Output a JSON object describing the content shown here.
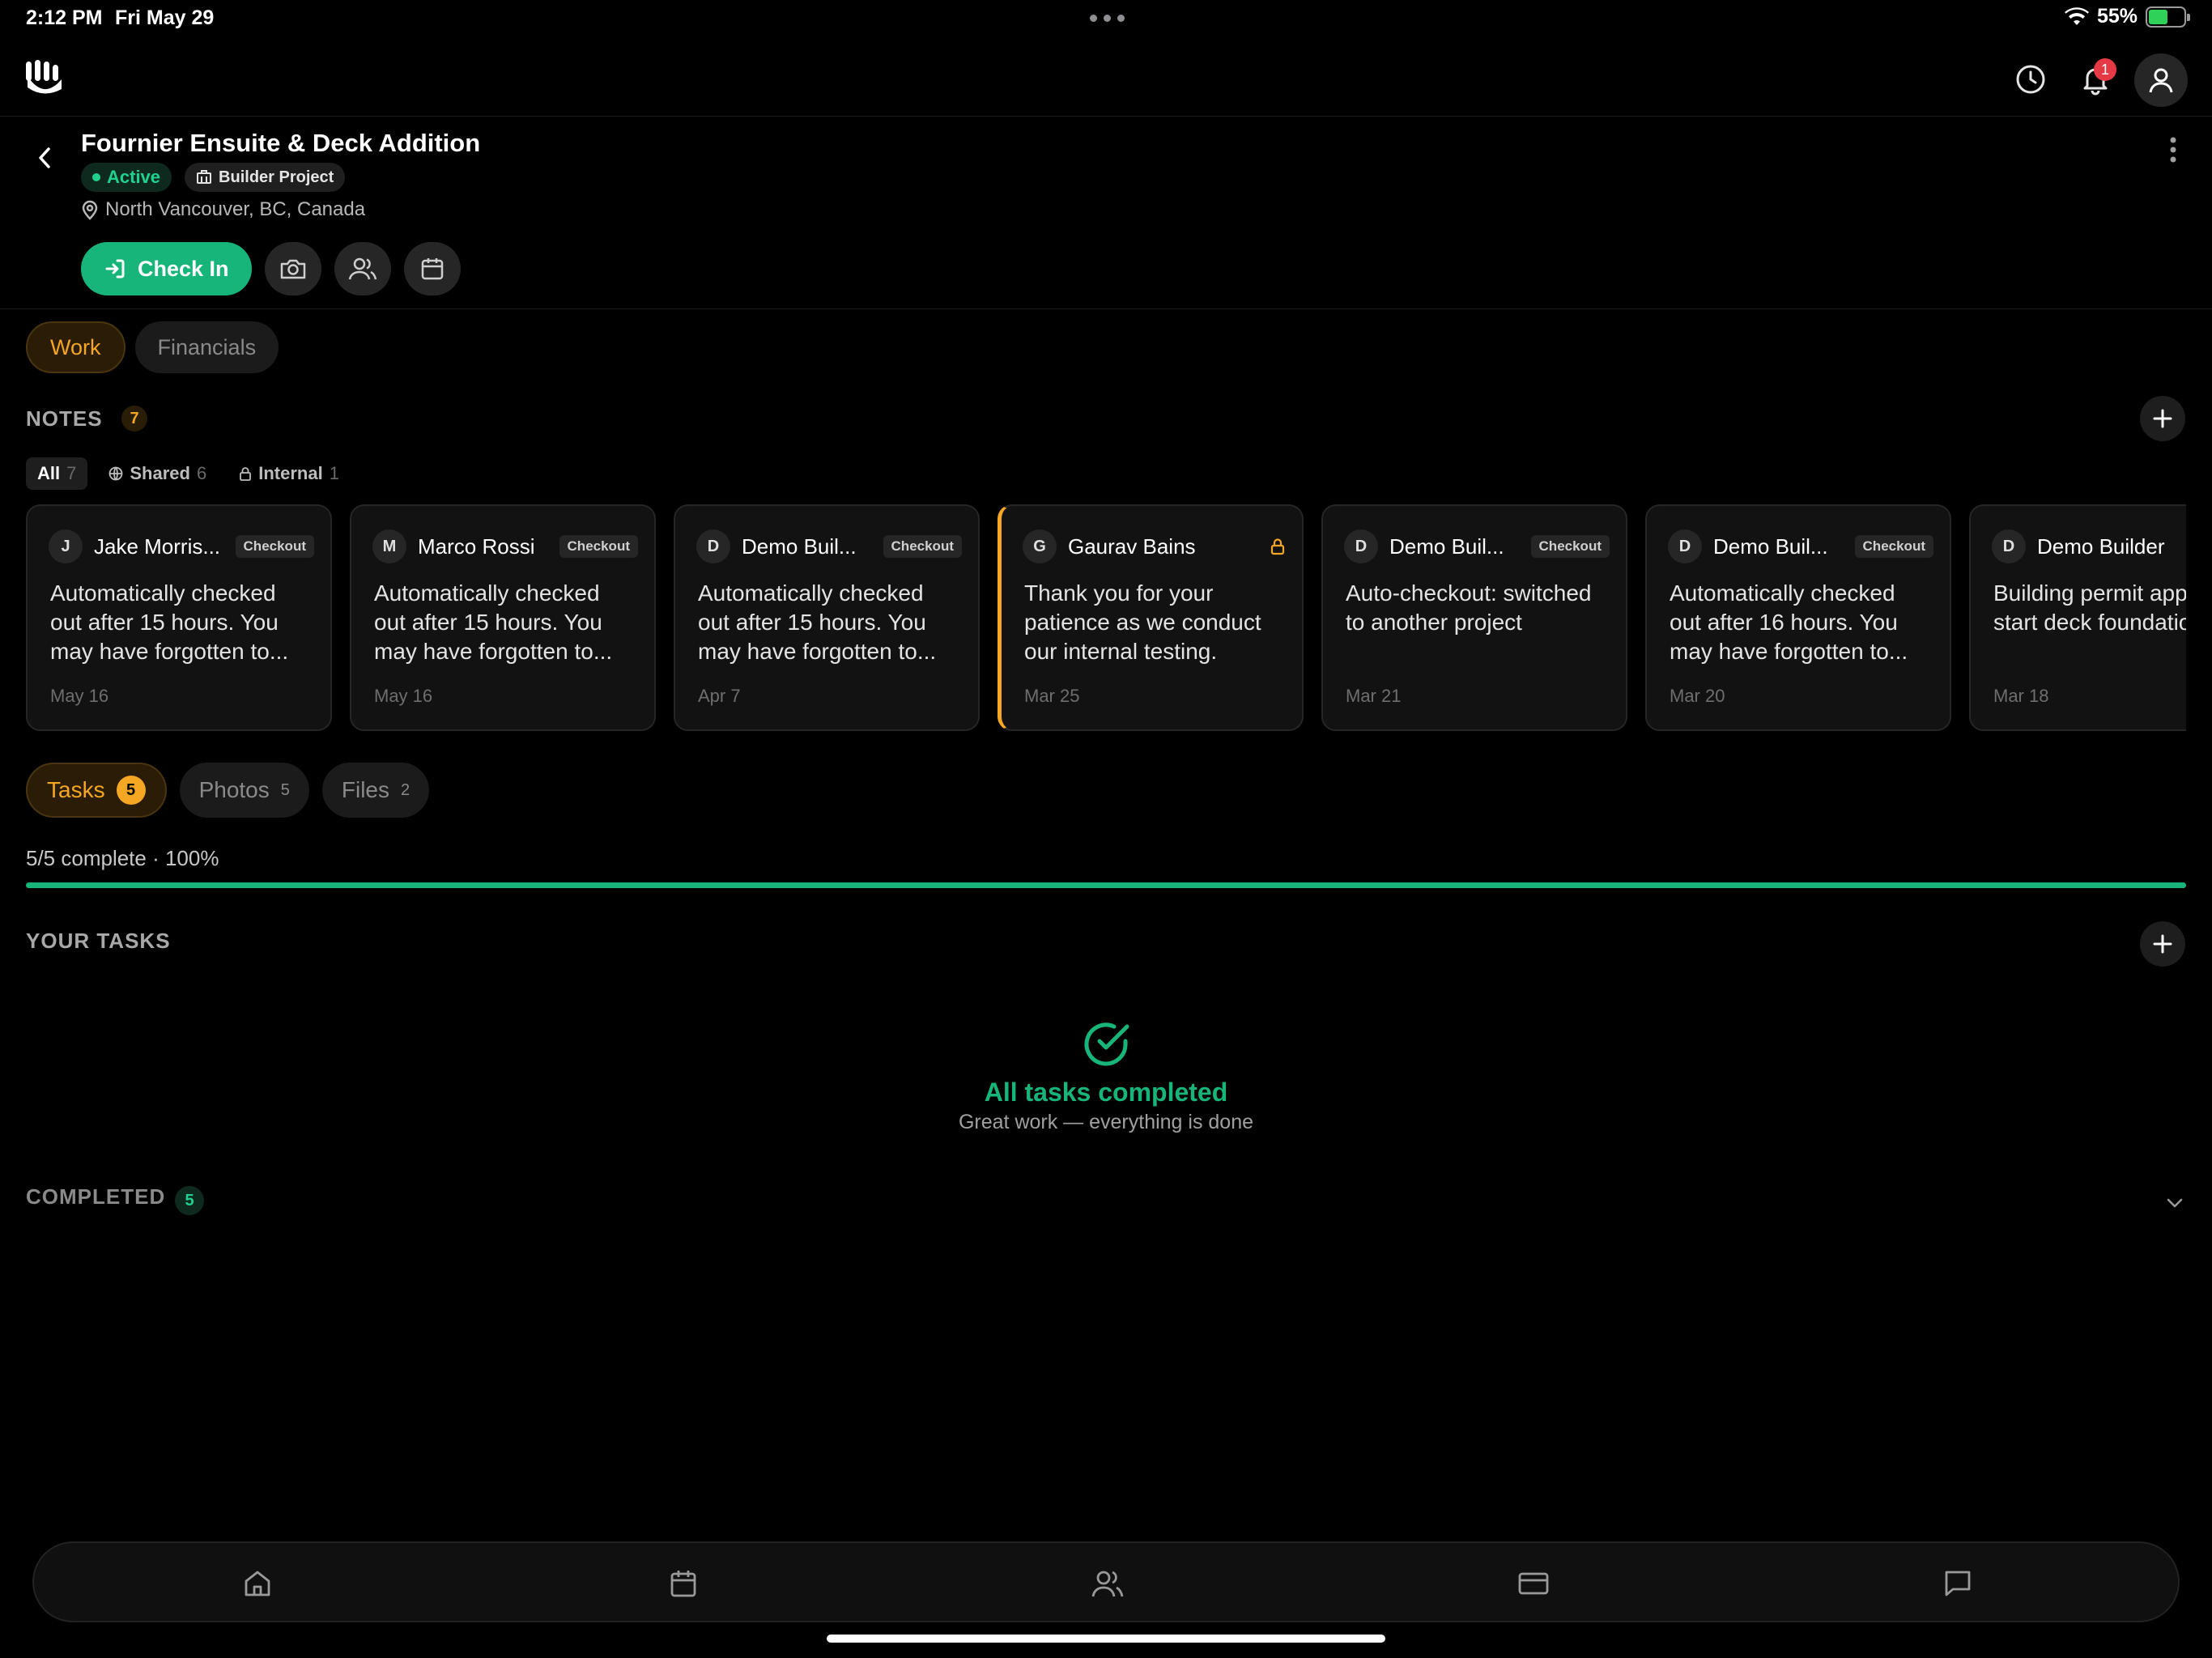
{
  "status_bar": {
    "time": "2:12 PM",
    "date": "Fri May 29",
    "battery": "55%"
  },
  "header": {
    "notification_count": "1"
  },
  "project": {
    "title": "Fournier Ensuite & Deck Addition",
    "status": "Active",
    "type": "Builder Project",
    "location": "North Vancouver, BC, Canada",
    "checkin_label": "Check In"
  },
  "segments": {
    "work": "Work",
    "financials": "Financials"
  },
  "notes": {
    "title": "NOTES",
    "count": "7",
    "filters": [
      {
        "label": "All",
        "count": "7"
      },
      {
        "label": "Shared",
        "count": "6"
      },
      {
        "label": "Internal",
        "count": "1"
      }
    ],
    "items": [
      {
        "initial": "J",
        "author": "Jake Morris...",
        "tag": "Checkout",
        "body": "Automatically checked out after 15 hours. You may have forgotten to...",
        "date": "May 16"
      },
      {
        "initial": "M",
        "author": "Marco Rossi",
        "tag": "Checkout",
        "body": "Automatically checked out after 15 hours. You may have forgotten to...",
        "date": "May 16"
      },
      {
        "initial": "D",
        "author": "Demo Buil...",
        "tag": "Checkout",
        "body": "Automatically checked out after 15 hours. You may have forgotten to...",
        "date": "Apr 7"
      },
      {
        "initial": "G",
        "author": "Gaurav Bains",
        "tag": "",
        "body": "Thank you for your patience as we conduct our internal testing.",
        "date": "Mar 25"
      },
      {
        "initial": "D",
        "author": "Demo Buil...",
        "tag": "Checkout",
        "body": "Auto-checkout: switched to another project",
        "date": "Mar 21"
      },
      {
        "initial": "D",
        "author": "Demo Buil...",
        "tag": "Checkout",
        "body": "Automatically checked out after 16 hours. You may have forgotten to...",
        "date": "Mar 20"
      },
      {
        "initial": "D",
        "author": "Demo Builder",
        "tag": "",
        "body": "Building permit approved. Can start deck foundation n",
        "date": "Mar 18"
      }
    ]
  },
  "content_tabs": [
    {
      "label": "Tasks",
      "count": "5"
    },
    {
      "label": "Photos",
      "count": "5"
    },
    {
      "label": "Files",
      "count": "2"
    }
  ],
  "progress": {
    "text": "5/5 complete · 100%",
    "fraction": 1.0
  },
  "your_tasks": {
    "title": "YOUR TASKS",
    "empty_title": "All tasks completed",
    "empty_subtitle": "Great work — everything is done"
  },
  "completed": {
    "title": "COMPLETED",
    "count": "5"
  },
  "colors": {
    "accent_green": "#17b57a",
    "accent_orange": "#f5a623",
    "notification_red": "#e63946"
  }
}
